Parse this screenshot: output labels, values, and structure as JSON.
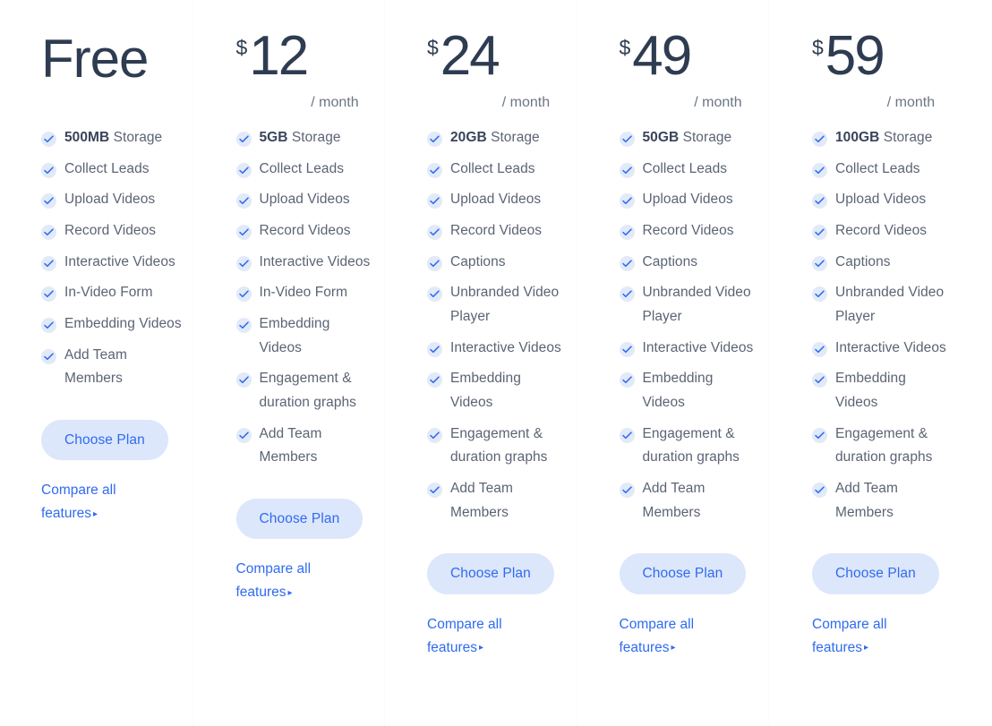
{
  "icons": {
    "check": "check-circle-icon",
    "arrow": "▸"
  },
  "labels": {
    "choose_plan": "Choose Plan",
    "compare_line1": "Compare all",
    "compare_line2": "features",
    "period": "/ month",
    "currency": "$"
  },
  "colors": {
    "accent_blue": "#2f6bf0",
    "button_bg": "#dde7fb",
    "check_bg": "#e2eaf9",
    "check_mark": "#2f6bf0",
    "heading": "#2e3c51",
    "body_text": "#5b6474",
    "page_bg": "#ffffff",
    "divider": "#fafbfd"
  },
  "plans": [
    {
      "id": "free",
      "is_free": true,
      "price_label": "Free",
      "price": null,
      "features": [
        {
          "strong": "500MB",
          "text": "Storage"
        },
        {
          "strong": null,
          "text": "Collect Leads"
        },
        {
          "strong": null,
          "text": "Upload Videos"
        },
        {
          "strong": null,
          "text": "Record Videos"
        },
        {
          "strong": null,
          "text": "Interactive Videos"
        },
        {
          "strong": null,
          "text": "In-Video Form"
        },
        {
          "strong": null,
          "text": "Embedding Videos"
        },
        {
          "strong": null,
          "text": "Add Team Members"
        }
      ]
    },
    {
      "id": "plan-12",
      "is_free": false,
      "price_label": "12",
      "price": 12,
      "features": [
        {
          "strong": "5GB",
          "text": "Storage"
        },
        {
          "strong": null,
          "text": "Collect Leads"
        },
        {
          "strong": null,
          "text": "Upload Videos"
        },
        {
          "strong": null,
          "text": "Record Videos"
        },
        {
          "strong": null,
          "text": "Interactive Videos"
        },
        {
          "strong": null,
          "text": "In-Video Form"
        },
        {
          "strong": null,
          "text": "Embedding Videos"
        },
        {
          "strong": null,
          "text": "Engagement & duration graphs"
        },
        {
          "strong": null,
          "text": "Add Team Members"
        }
      ]
    },
    {
      "id": "plan-24",
      "is_free": false,
      "price_label": "24",
      "price": 24,
      "features": [
        {
          "strong": "20GB",
          "text": "Storage"
        },
        {
          "strong": null,
          "text": "Collect Leads"
        },
        {
          "strong": null,
          "text": "Upload Videos"
        },
        {
          "strong": null,
          "text": "Record Videos"
        },
        {
          "strong": null,
          "text": "Captions"
        },
        {
          "strong": null,
          "text": "Unbranded Video Player"
        },
        {
          "strong": null,
          "text": "Interactive Videos"
        },
        {
          "strong": null,
          "text": "Embedding Videos"
        },
        {
          "strong": null,
          "text": "Engagement & duration graphs"
        },
        {
          "strong": null,
          "text": "Add Team Members"
        }
      ]
    },
    {
      "id": "plan-49",
      "is_free": false,
      "price_label": "49",
      "price": 49,
      "features": [
        {
          "strong": "50GB",
          "text": "Storage"
        },
        {
          "strong": null,
          "text": "Collect Leads"
        },
        {
          "strong": null,
          "text": "Upload Videos"
        },
        {
          "strong": null,
          "text": "Record Videos"
        },
        {
          "strong": null,
          "text": "Captions"
        },
        {
          "strong": null,
          "text": "Unbranded Video Player"
        },
        {
          "strong": null,
          "text": "Interactive Videos"
        },
        {
          "strong": null,
          "text": "Embedding Videos"
        },
        {
          "strong": null,
          "text": "Engagement & duration graphs"
        },
        {
          "strong": null,
          "text": "Add Team Members"
        }
      ]
    },
    {
      "id": "plan-59",
      "is_free": false,
      "price_label": "59",
      "price": 59,
      "features": [
        {
          "strong": "100GB",
          "text": "Storage"
        },
        {
          "strong": null,
          "text": "Collect Leads"
        },
        {
          "strong": null,
          "text": "Upload Videos"
        },
        {
          "strong": null,
          "text": "Record Videos"
        },
        {
          "strong": null,
          "text": "Captions"
        },
        {
          "strong": null,
          "text": "Unbranded Video Player"
        },
        {
          "strong": null,
          "text": "Interactive Videos"
        },
        {
          "strong": null,
          "text": "Embedding Videos"
        },
        {
          "strong": null,
          "text": "Engagement & duration graphs"
        },
        {
          "strong": null,
          "text": "Add Team Members"
        }
      ]
    }
  ]
}
